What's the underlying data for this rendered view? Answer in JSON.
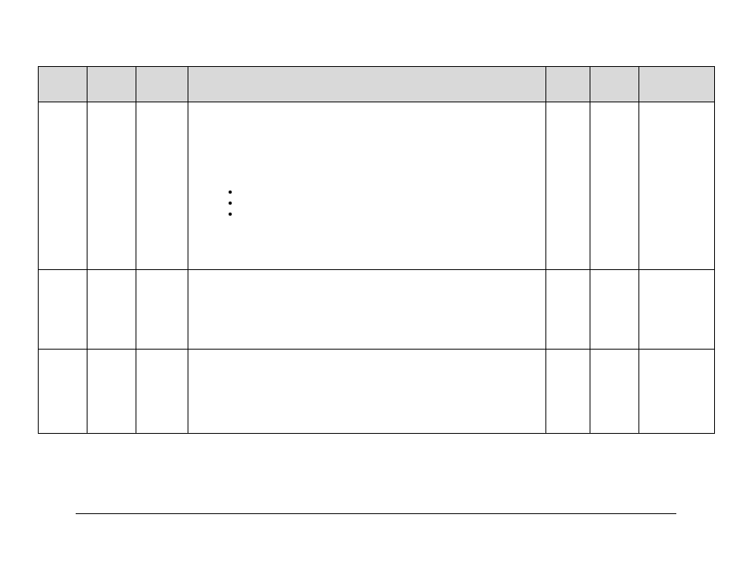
{
  "table": {
    "headers": [
      "",
      "",
      "",
      "",
      "",
      "",
      ""
    ],
    "rows": [
      {
        "cells": [
          "",
          "",
          "",
          "",
          "",
          "",
          ""
        ]
      },
      {
        "cells": [
          "",
          "",
          "",
          "",
          "",
          "",
          ""
        ]
      },
      {
        "cells": [
          "",
          "",
          "",
          "",
          "",
          "",
          ""
        ]
      }
    ]
  },
  "bullets": [
    "",
    "",
    ""
  ]
}
